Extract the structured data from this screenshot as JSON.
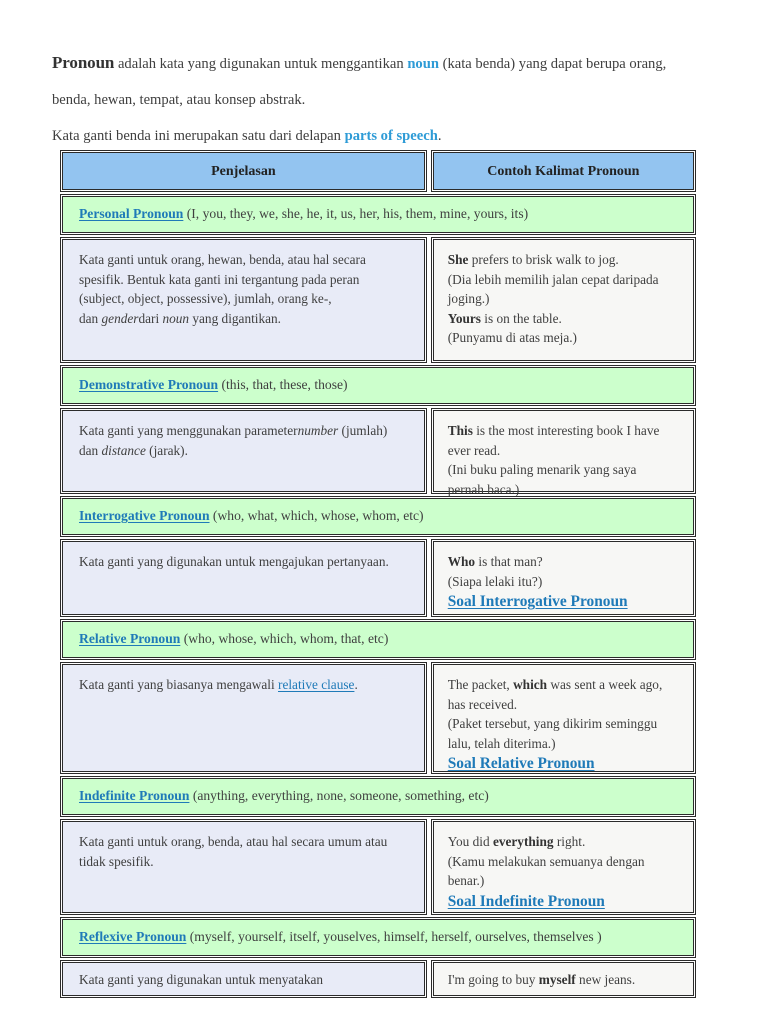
{
  "intro": {
    "lead_word": "Pronoun",
    "line1_a": " adalah kata yang digunakan untuk menggantikan ",
    "link_noun": "noun",
    "line1_b": " (kata benda) yang dapat berupa orang,",
    "line2": "benda, hewan, tempat, atau konsep abstrak.",
    "line3_a": "Kata ganti benda ini merupakan satu dari delapan ",
    "link_parts": "parts of speech",
    "line3_b": "."
  },
  "table": {
    "headers": {
      "col1": "Penjelasan",
      "col2": "Contoh Kalimat Pronoun"
    },
    "sections": [
      {
        "title_link": "Personal Pronoun",
        "title_rest": " (I, you, they, we, she, he, it, us, her, his, them, mine, yours, its)",
        "desc_line1": "Kata ganti untuk orang, hewan, benda, atau hal secara",
        "desc_line2": "spesifik. Bentuk kata ganti ini tergantung pada peran",
        "desc_line3": "(subject, object, possessive), jumlah, orang ke-,",
        "desc_line4_a": "dan ",
        "desc_line4_it1": "gender",
        "desc_line4_b": "dari ",
        "desc_line4_it2": "noun",
        "desc_line4_c": " yang digantikan.",
        "ex_bold1": "She",
        "ex_text1": " prefers to brisk walk to jog.",
        "ex_text2": "(Dia lebih memilih jalan cepat daripada",
        "ex_text3": "joging.)",
        "ex_bold2": "Yours",
        "ex_text4": " is on the table.",
        "ex_text5": "(Punyamu di atas meja.)"
      },
      {
        "title_link": "Demonstrative Pronoun",
        "title_rest": " (this, that, these, those)",
        "desc_line1_a": "Kata ganti yang menggunakan parameter",
        "desc_line1_it": "number",
        "desc_line1_b": " (jumlah)",
        "desc_line2_a": "dan ",
        "desc_line2_it": "distance",
        "desc_line2_b": " (jarak).",
        "ex_bold1": "This",
        "ex_text1": " is the most interesting book I have",
        "ex_text2": "ever read.",
        "ex_text3": "(Ini buku paling menarik yang saya",
        "ex_text4": "pernah baca.)"
      },
      {
        "title_link": "Interrogative Pronoun",
        "title_rest": " (who, what, which, whose, whom, etc)",
        "desc_line1": "Kata ganti yang digunakan untuk mengajukan pertanyaan.",
        "ex_bold1": "Who",
        "ex_text1": " is that man?",
        "ex_text2": "(Siapa lelaki itu?)",
        "ex_link": "Soal Interrogative Pronoun"
      },
      {
        "title_link": "Relative Pronoun",
        "title_rest": " (who, whose, which, whom, that, etc)",
        "desc_line1_a": "Kata ganti yang biasanya mengawali ",
        "desc_line1_link": "relative clause",
        "desc_line1_b": ".",
        "ex_text1_a": "The packet, ",
        "ex_bold1": "which",
        "ex_text1_b": " was sent a week ago,",
        "ex_text2": "has received.",
        "ex_text3": "(Paket tersebut, yang dikirim seminggu",
        "ex_text4": "lalu, telah diterima.)",
        "ex_link": "Soal Relative Pronoun"
      },
      {
        "title_link": "Indefinite Pronoun",
        "title_rest": " (anything, everything, none, someone, something, etc)",
        "desc_line1": "Kata ganti untuk orang, benda, atau hal secara umum atau",
        "desc_line2": "tidak spesifik.",
        "ex_text1_a": "You did ",
        "ex_bold1": "everything",
        "ex_text1_b": " right.",
        "ex_text2": "(Kamu melakukan semuanya dengan",
        "ex_text3": "benar.)",
        "ex_link": "Soal Indefinite Pronoun"
      },
      {
        "title_link": "Reflexive Pronoun",
        "title_rest": " (myself, yourself, itself, youselves, himself, herself, ourselves, themselves )",
        "desc_line1": "Kata ganti yang digunakan untuk menyatakan",
        "ex_text1_a": "I'm going to buy ",
        "ex_bold1": "myself",
        "ex_text1_b": " new jeans."
      }
    ]
  },
  "colors": {
    "header_blue": "#93C4F0",
    "section_green": "#CCFFCC",
    "desc_lavender": "#E8EBF7",
    "example_gray": "#F7F7F5",
    "link_blue": "#1F7AB8",
    "intro_link_blue": "#2E9BD6"
  }
}
